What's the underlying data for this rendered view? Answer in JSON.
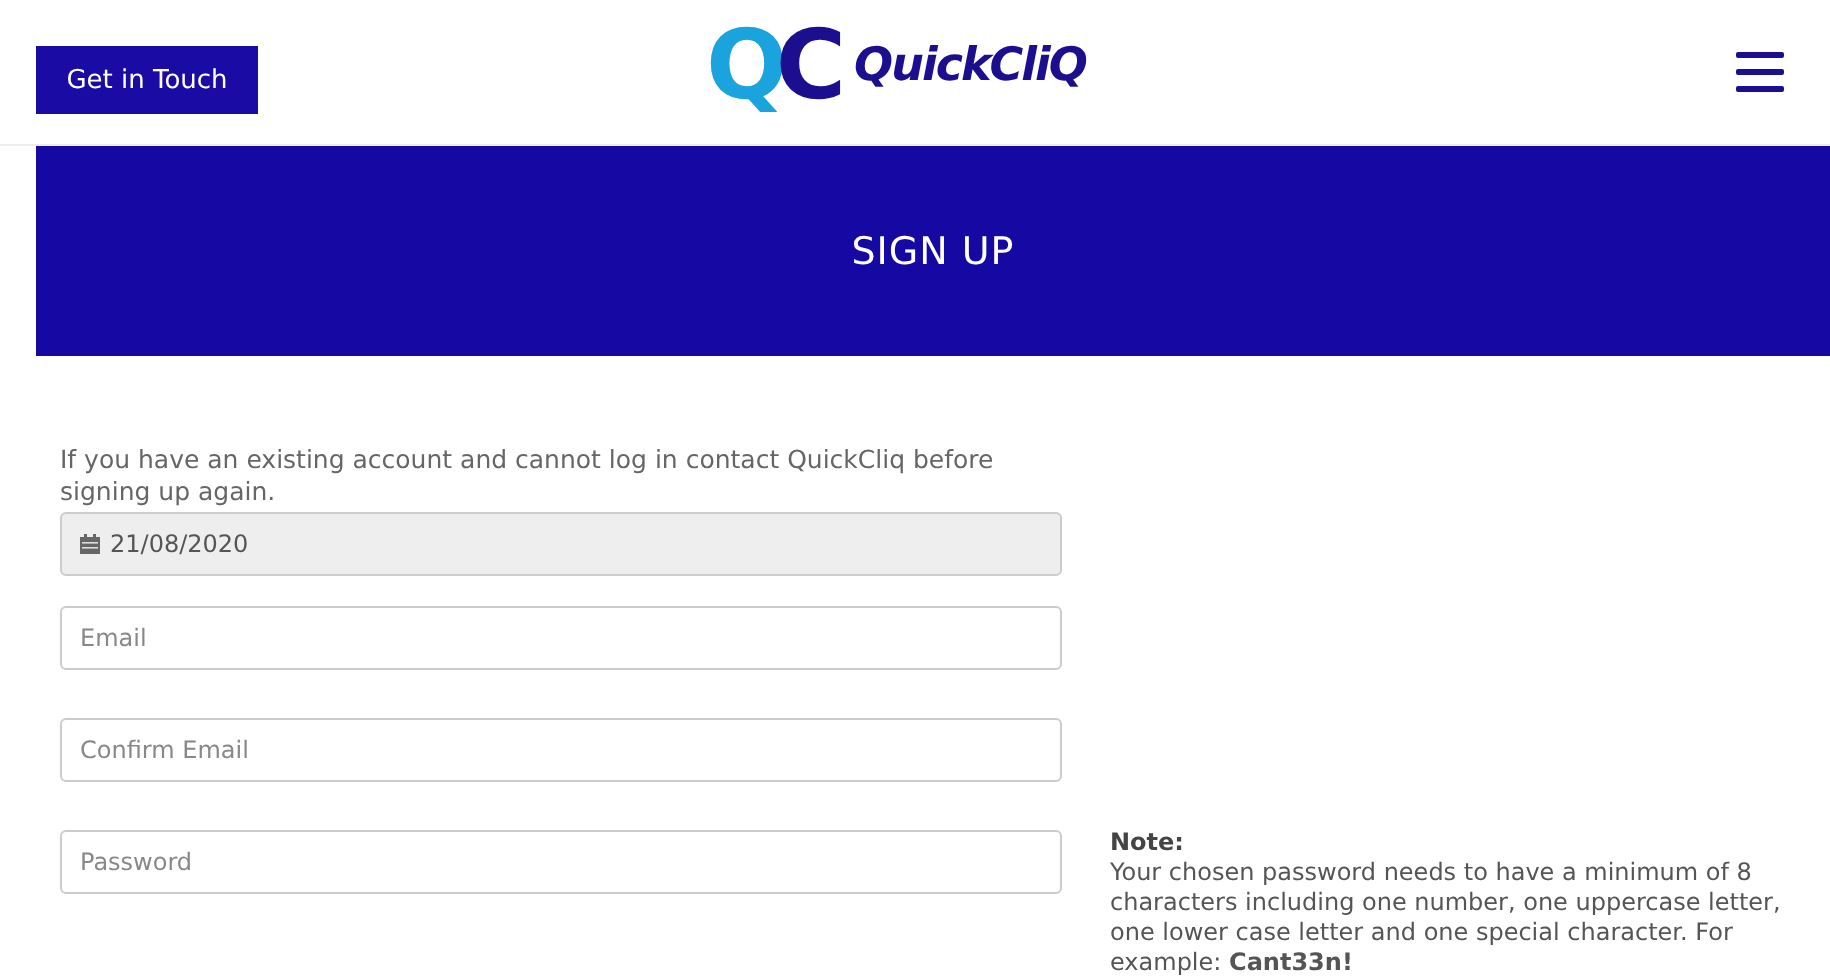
{
  "header": {
    "button": "Get in Touch",
    "logo": {
      "mark": [
        "Q",
        "C"
      ],
      "name": "QuickCliQ"
    }
  },
  "banner": {
    "title": "SIGN UP"
  },
  "form": {
    "intro": "If you have an existing account and cannot log in contact QuickCliq before signing up again.",
    "fields": [
      {
        "kind": "date",
        "value": "21/08/2020",
        "disabled": true
      },
      {
        "kind": "text",
        "placeholder": "Email",
        "disabled": false
      },
      {
        "kind": "text",
        "placeholder": "Confirm Email",
        "disabled": false
      },
      {
        "kind": "text",
        "placeholder": "Password",
        "disabled": false
      }
    ]
  },
  "note": {
    "title": "Note:",
    "text": "Your chosen password needs to have a minimum of 8 characters including one number, one uppercase letter, one lower case letter and one special character. For example: **Cant33n!**"
  }
}
